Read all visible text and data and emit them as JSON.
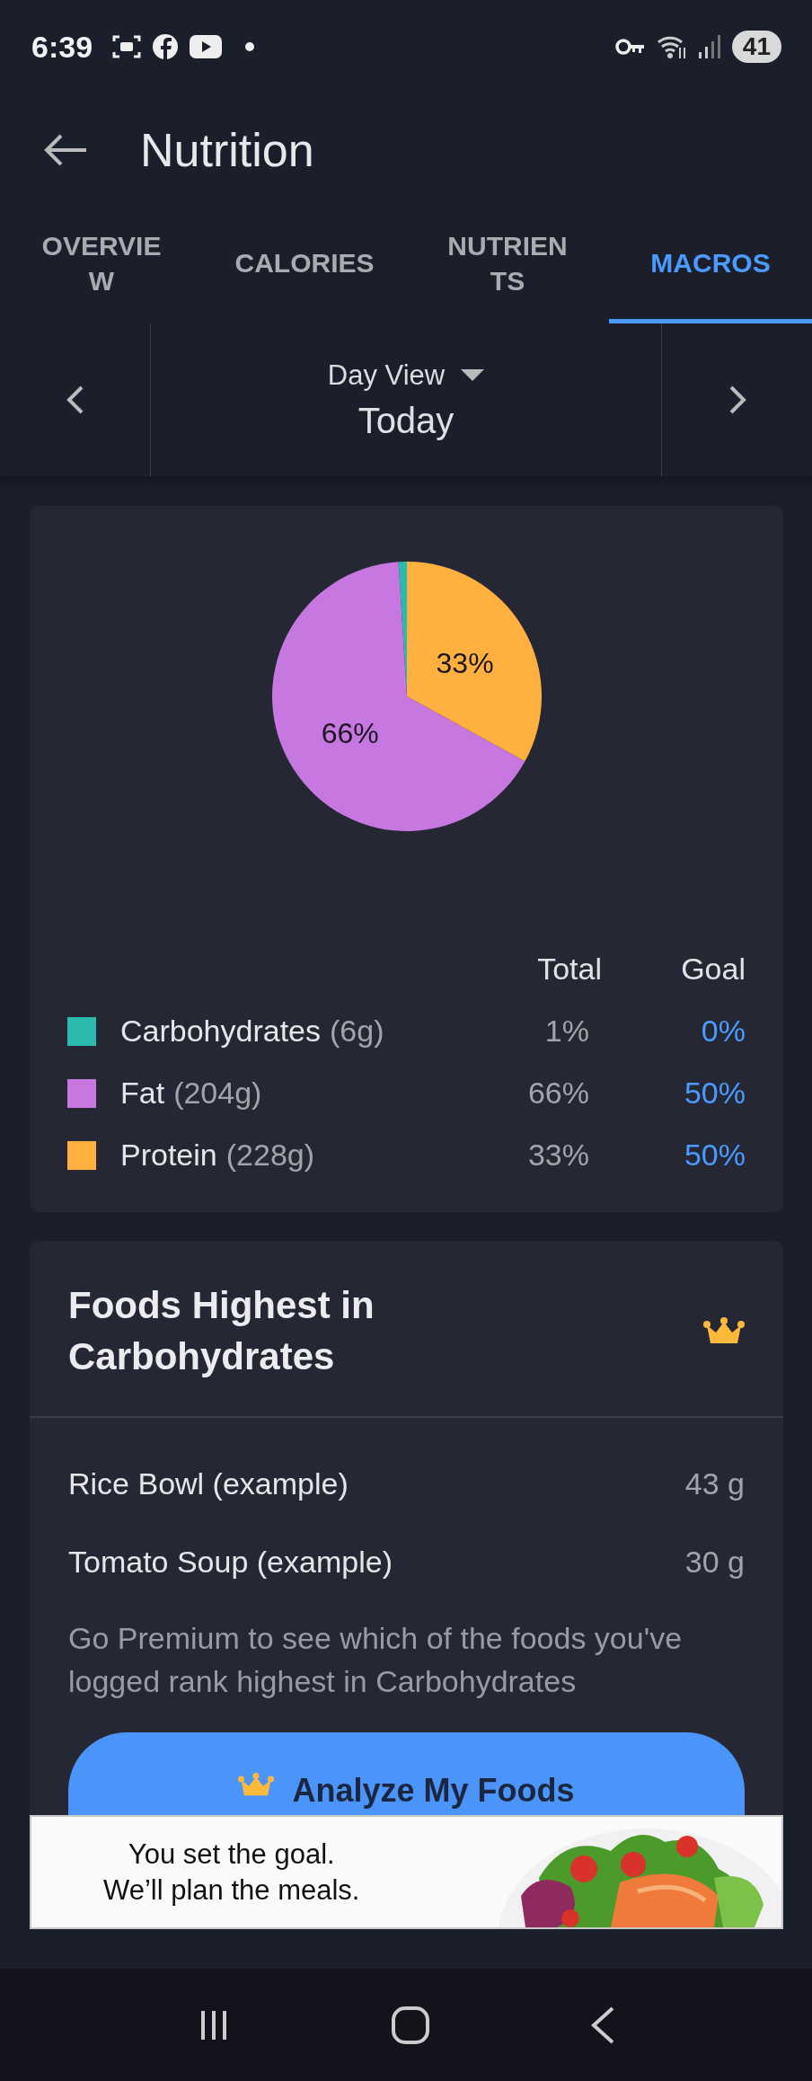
{
  "status_bar": {
    "time": "6:39",
    "battery": "41"
  },
  "header": {
    "title": "Nutrition"
  },
  "tabs": [
    {
      "label": "OVERVIEW",
      "selected": false
    },
    {
      "label": "CALORIES",
      "selected": false
    },
    {
      "label": "NUTRIENTS",
      "selected": false
    },
    {
      "label": "MACROS",
      "selected": true
    }
  ],
  "date_nav": {
    "view": "Day View",
    "date": "Today"
  },
  "macros_card": {
    "chart_data": {
      "type": "pie",
      "values": [
        1,
        66,
        33
      ],
      "value_labels": [
        null,
        "66%",
        "33%"
      ]
    },
    "columns": [
      "Total",
      "Goal"
    ],
    "rows": [
      {
        "name": "Carbohydrates",
        "amount": "(6g)",
        "total": "1%",
        "goal": "0%",
        "color": "#2bbbad"
      },
      {
        "name": "Fat",
        "amount": "(204g)",
        "total": "66%",
        "goal": "50%",
        "color": "#c678e0"
      },
      {
        "name": "Protein",
        "amount": "(228g)",
        "total": "33%",
        "goal": "50%",
        "color": "#ffb03f"
      }
    ]
  },
  "foods_card": {
    "title": "Foods Highest in Carbohydrates",
    "rows": [
      {
        "name": "Rice Bowl (example)",
        "value": "43 g"
      },
      {
        "name": "Tomato Soup (example)",
        "value": "30 g"
      }
    ],
    "message": "Go Premium to see which of the foods you've logged rank highest in Carbohydrates",
    "button": "Analyze My Foods"
  },
  "ad": {
    "lines": [
      "You set the goal.",
      "We’ll plan the meals."
    ],
    "kind": "picture"
  }
}
